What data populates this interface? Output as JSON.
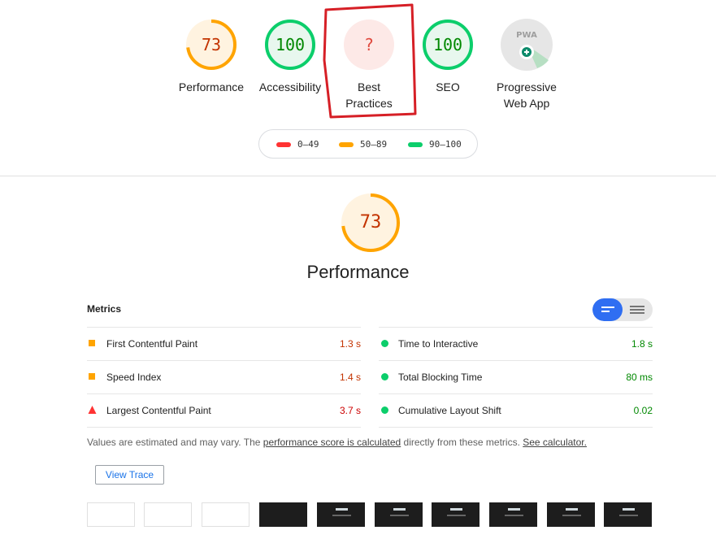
{
  "gauges": [
    {
      "score": "73",
      "label": "Performance",
      "color": "#ffa400",
      "bg": "#fff3e0",
      "fraction": 0.73
    },
    {
      "score": "100",
      "label": "Accessibility",
      "color": "#0cce6b",
      "bg": "#e8f7ee",
      "fraction": 1.0
    },
    {
      "score": "?",
      "label": "Best\nPractices",
      "color": "#f33",
      "bg": "#fde9e7",
      "fraction": 0
    },
    {
      "score": "100",
      "label": "SEO",
      "color": "#0cce6b",
      "bg": "#e8f7ee",
      "fraction": 1.0
    },
    {
      "score": "",
      "label": "Progressive\nWeb App",
      "badge": "PWA"
    }
  ],
  "legend": [
    {
      "range": "0–49",
      "color": "#f33"
    },
    {
      "range": "50–89",
      "color": "#ffa400"
    },
    {
      "range": "90–100",
      "color": "#0cce6b"
    }
  ],
  "performance": {
    "score": "73",
    "title": "Performance",
    "fraction": 0.73
  },
  "metrics": {
    "title": "Metrics",
    "left": [
      {
        "name": "First Contentful Paint",
        "value": "1.3 s",
        "status": "average"
      },
      {
        "name": "Speed Index",
        "value": "1.4 s",
        "status": "average"
      },
      {
        "name": "Largest Contentful Paint",
        "value": "3.7 s",
        "status": "fail"
      }
    ],
    "right": [
      {
        "name": "Time to Interactive",
        "value": "1.8 s",
        "status": "pass"
      },
      {
        "name": "Total Blocking Time",
        "value": "80 ms",
        "status": "pass"
      },
      {
        "name": "Cumulative Layout Shift",
        "value": "0.02",
        "status": "pass"
      }
    ]
  },
  "note": {
    "prefix": "Values are estimated and may vary. The ",
    "link1": "performance score is calculated",
    "middle": " directly from these metrics. ",
    "link2": "See calculator."
  },
  "view_trace": "View Trace",
  "colors": {
    "pass": "#0cce6b",
    "average": "#ffa400",
    "fail": "#f33",
    "pass_text": "#008800",
    "average_text": "#c33300",
    "fail_text": "#cc0000"
  }
}
